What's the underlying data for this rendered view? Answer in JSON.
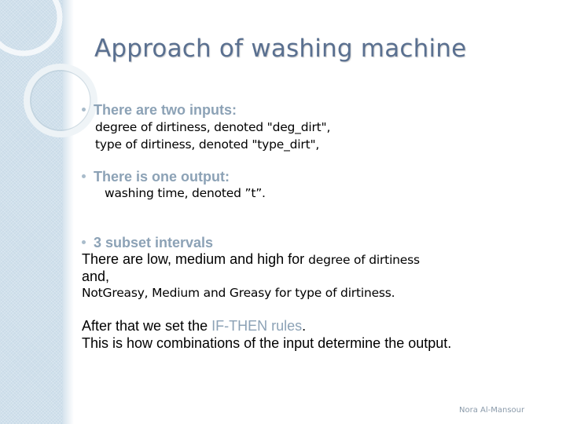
{
  "title": "Approach of washing machine",
  "inputs": {
    "heading": "There are two inputs:",
    "line1": "degree of dirtiness, denoted \"deg_dirt\",",
    "line2": "type of dirtiness,  denoted \"type_dirt\","
  },
  "output": {
    "heading": "There is one output:",
    "line1": "washing time, denoted ”t”."
  },
  "intervals": {
    "heading": "3 subset intervals",
    "line1_a": "There are low, medium and high for ",
    "line1_b": "degree of dirtiness",
    "line2": "and,",
    "line3_a": "NotGreasy, Medium and Greasy for ",
    "line3_b": "type of dirtiness."
  },
  "rules": {
    "line1_a": "After that we set the ",
    "line1_link": "IF-THEN rules",
    "line1_b": ".",
    "line2": "This is how combinations of the input determine the output."
  },
  "footer": "Nora Al-Mansour",
  "colors": {
    "title": "#5a7090",
    "accent": "#8ca2b6",
    "band": "#c9dbe8"
  }
}
